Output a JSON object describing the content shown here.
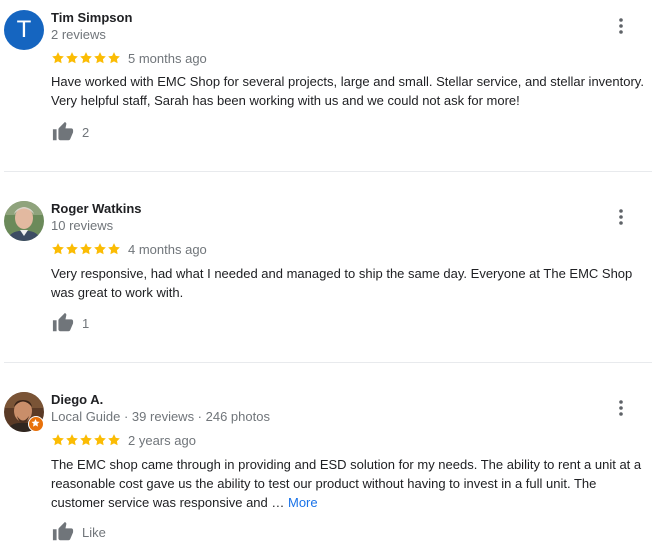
{
  "colors": {
    "star": "#fbbc04",
    "link": "#1a73e8",
    "avatar_t": "#1565c0",
    "badge": "#e8710a",
    "secondary_text": "#70757a"
  },
  "reviews": [
    {
      "avatar_letter": "T",
      "name": "Tim Simpson",
      "meta": "2 reviews",
      "rating": 5,
      "age": "5 months ago",
      "text": "Have worked with EMC Shop for several projects, large and small. Stellar service, and stellar inventory. Very helpful staff, Sarah has been working with us and we could not ask for more!",
      "likes": "2"
    },
    {
      "name": "Roger Watkins",
      "meta": "10 reviews",
      "rating": 5,
      "age": "4 months ago",
      "text": "Very responsive, had what I needed and managed to ship the same day. Everyone at The EMC Shop was great to work with.",
      "likes": "1"
    },
    {
      "name": "Diego A.",
      "meta": "Local Guide · 39 reviews · 246 photos",
      "rating": 5,
      "age": "2 years ago",
      "text": "The EMC shop came through in providing and ESD solution for my needs. The ability to rent a unit at a reasonable cost gave us the ability to test our product without having to invest in a full unit. The customer service was responsive and …",
      "more_label": "More",
      "likes": "Like"
    }
  ],
  "icons": {
    "menu": "more-vert-icon",
    "like": "thumb-up-icon",
    "star": "star-icon",
    "guide": "local-guide-badge-icon"
  }
}
